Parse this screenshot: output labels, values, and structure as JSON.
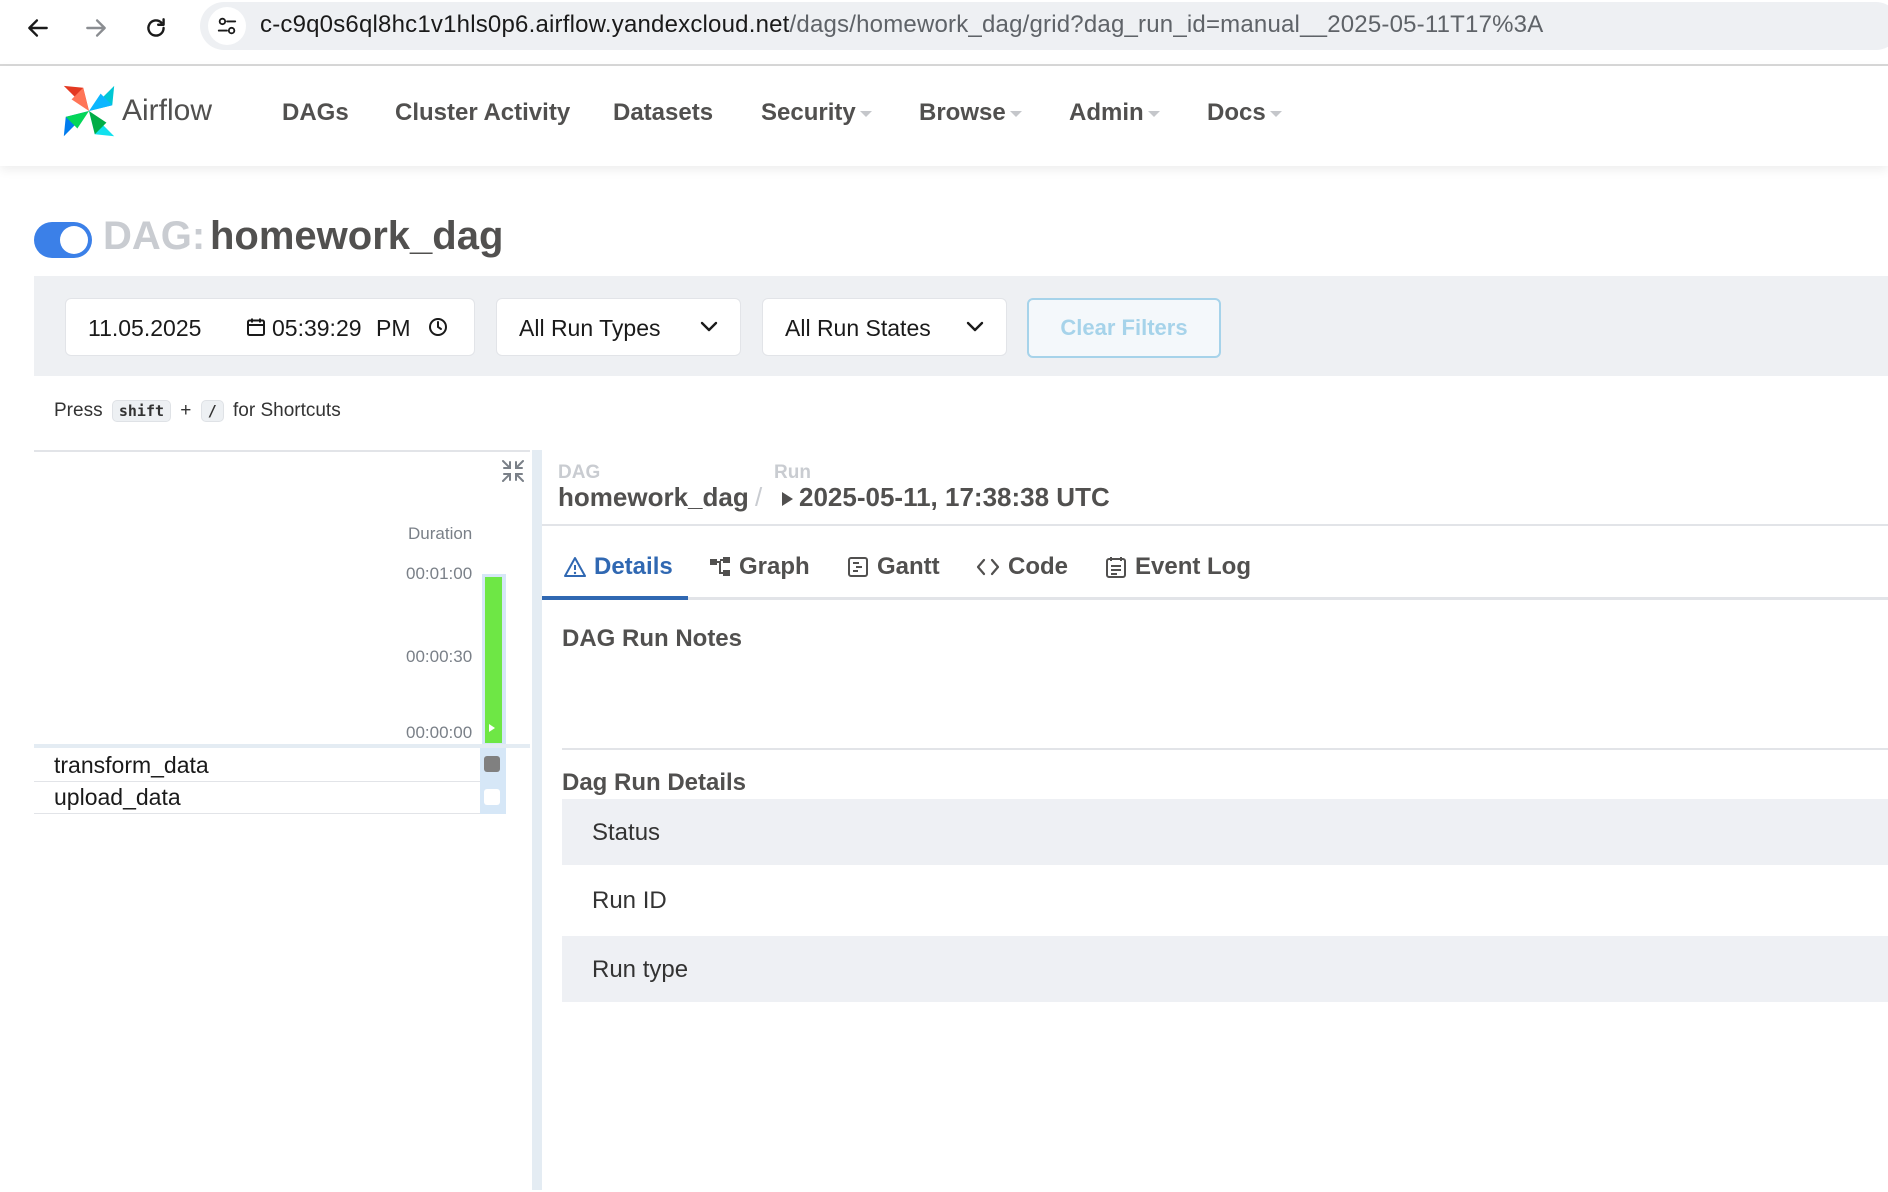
{
  "browser": {
    "url_host": "c-c9q0s6ql8hc1v1hls0p6.airflow.yandexcloud.net",
    "url_path": "/dags/homework_dag/grid?dag_run_id=manual__2025-05-11T17%3A"
  },
  "navbar": {
    "logo_text": "Airflow",
    "items": [
      {
        "label": "DAGs"
      },
      {
        "label": "Cluster Activity"
      },
      {
        "label": "Datasets"
      },
      {
        "label": "Security"
      },
      {
        "label": "Browse"
      },
      {
        "label": "Admin"
      },
      {
        "label": "Docs"
      }
    ]
  },
  "dag": {
    "prefix": "DAG:",
    "name": "homework_dag",
    "paused": false
  },
  "filters": {
    "date": "11.05.2025",
    "time": "05:39:29",
    "ampm": "PM",
    "run_types": "All Run Types",
    "run_states": "All Run States",
    "clear_label": "Clear Filters"
  },
  "shortcut_hint": {
    "press": "Press",
    "key1": "shift",
    "plus": "+",
    "key2": "/",
    "suffix": "for Shortcuts"
  },
  "grid": {
    "duration_label": "Duration",
    "ticks": [
      "00:01:00",
      "00:00:30",
      "00:00:00"
    ],
    "run_duration_fraction": 1.0,
    "run_state_color": "#6ee745",
    "tasks": [
      {
        "name": "transform_data",
        "state_color": "#808080"
      },
      {
        "name": "upload_data",
        "state_color": "#ffffff"
      }
    ]
  },
  "details": {
    "crumb_dag_label": "DAG",
    "crumb_dag_value": "homework_dag",
    "crumb_sep": "/",
    "crumb_run_label": "Run",
    "crumb_run_value": "2025-05-11, 17:38:38 UTC",
    "tabs": [
      {
        "label": "Details",
        "icon": "warning-triangle-icon",
        "active": true
      },
      {
        "label": "Graph",
        "icon": "graph-icon"
      },
      {
        "label": "Gantt",
        "icon": "gantt-icon"
      },
      {
        "label": "Code",
        "icon": "code-icon"
      },
      {
        "label": "Event Log",
        "icon": "event-log-icon"
      }
    ],
    "notes_title": "DAG Run Notes",
    "run_details_title": "Dag Run Details",
    "rows": [
      "Status",
      "Run ID",
      "Run type"
    ]
  },
  "colors": {
    "accent": "#3068b2",
    "toggle": "#3b80e8",
    "success": "#6ee745"
  }
}
